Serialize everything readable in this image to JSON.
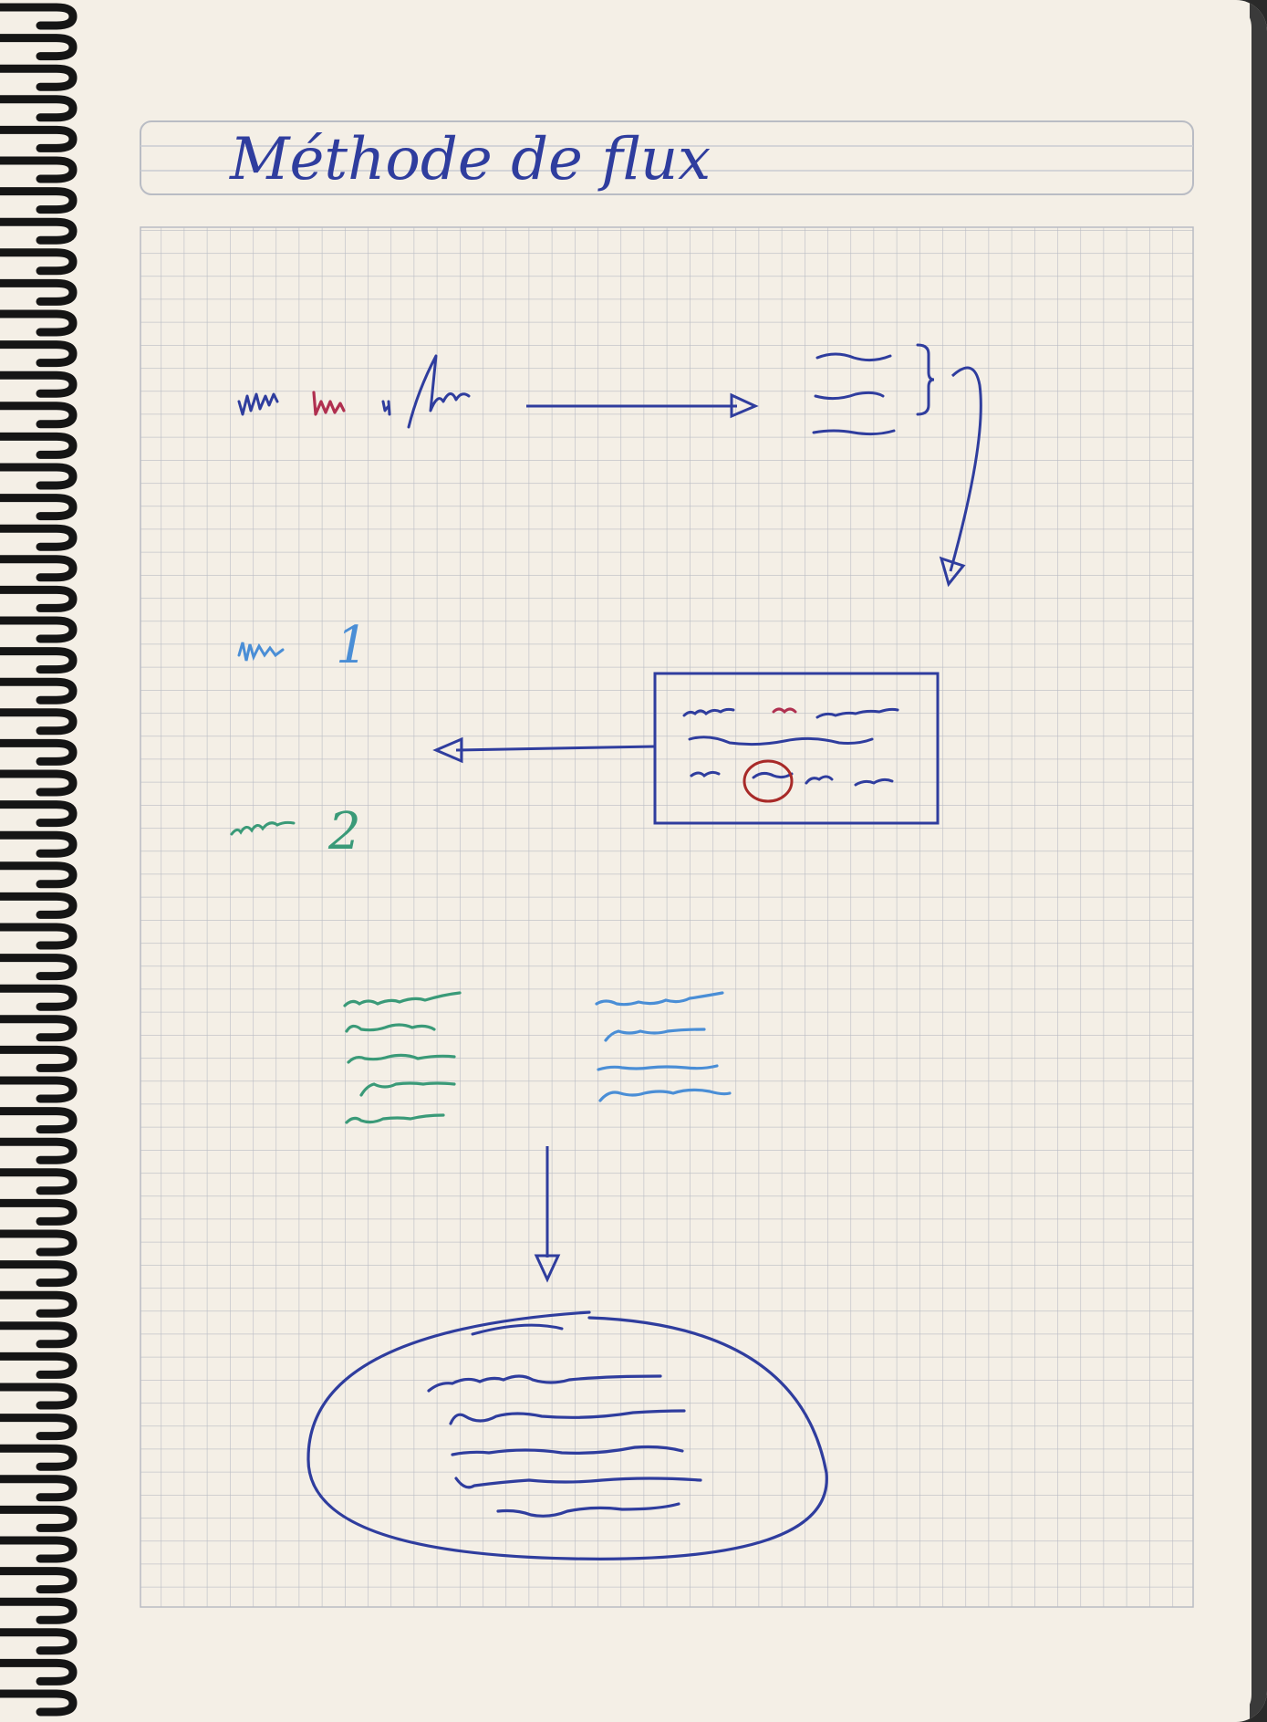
{
  "page": {
    "title": "Méthode de flux",
    "label_one": "1",
    "label_two": "2"
  },
  "colors": {
    "paper": "#f4efe6",
    "grid": "#b9bcc4",
    "ink_blue": "#2f3d9e",
    "ink_light_blue": "#4a8ed6",
    "ink_green": "#3a9a78",
    "ink_red": "#b03050",
    "ink_dark_red": "#a82a28",
    "binding": "#151515"
  },
  "icons": {
    "binding": "spiral-binding-icon",
    "arrow": "arrow-head-icon"
  }
}
